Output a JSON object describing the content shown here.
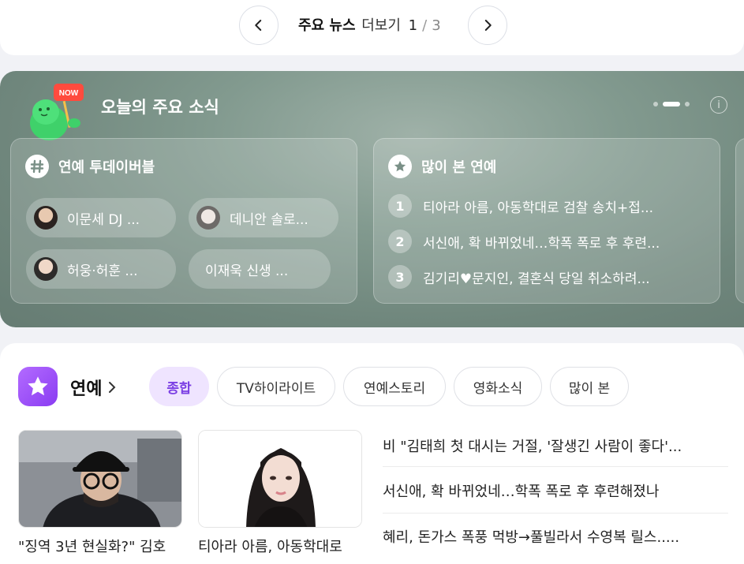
{
  "pager": {
    "title": "주요 뉴스",
    "more": "더보기",
    "current": "1",
    "separator": "/",
    "total": "3"
  },
  "today": {
    "title": "오늘의 주요 소식",
    "mascot_badge": "NOW",
    "info_label": "i",
    "cards": {
      "trending": {
        "title": "연예 투데이버블",
        "chips": [
          "이문세 DJ ...",
          "데니안 솔로...",
          "허웅·허훈 ...",
          "이재욱 신생 ..."
        ]
      },
      "most_viewed": {
        "title": "많이 본 연예",
        "items": [
          {
            "rank": "1",
            "text": "티아라 아름, 아동학대로 검찰 송치+접..."
          },
          {
            "rank": "2",
            "text": "서신애, 확 바뀌었네…학폭 폭로 후 후련..."
          },
          {
            "rank": "3",
            "text": "김기리♥문지인, 결혼식 당일 취소하려..."
          }
        ]
      }
    }
  },
  "entertainment": {
    "title": "연예",
    "tabs": [
      "종합",
      "TV하이라이트",
      "연예스토리",
      "영화소식",
      "많이 본"
    ],
    "active_tab": "종합",
    "thumbs": [
      {
        "caption": "\"징역 3년 현실화?\" 김호"
      },
      {
        "caption": "티아라 아름, 아동학대로"
      }
    ],
    "headlines": [
      "비 \"김태희 첫 대시는 거절, '잘생긴 사람이 좋다'...",
      "서신애, 확 바뀌었네…학폭 폭로 후 후련해졌나",
      "혜리, 돈가스 폭풍 먹방→풀빌라서 수영복 릴스....."
    ]
  },
  "colors": {
    "panel_bg": "#7a9087",
    "accent_purple": "#8a3cf2",
    "active_tab_bg": "#efe4ff"
  }
}
